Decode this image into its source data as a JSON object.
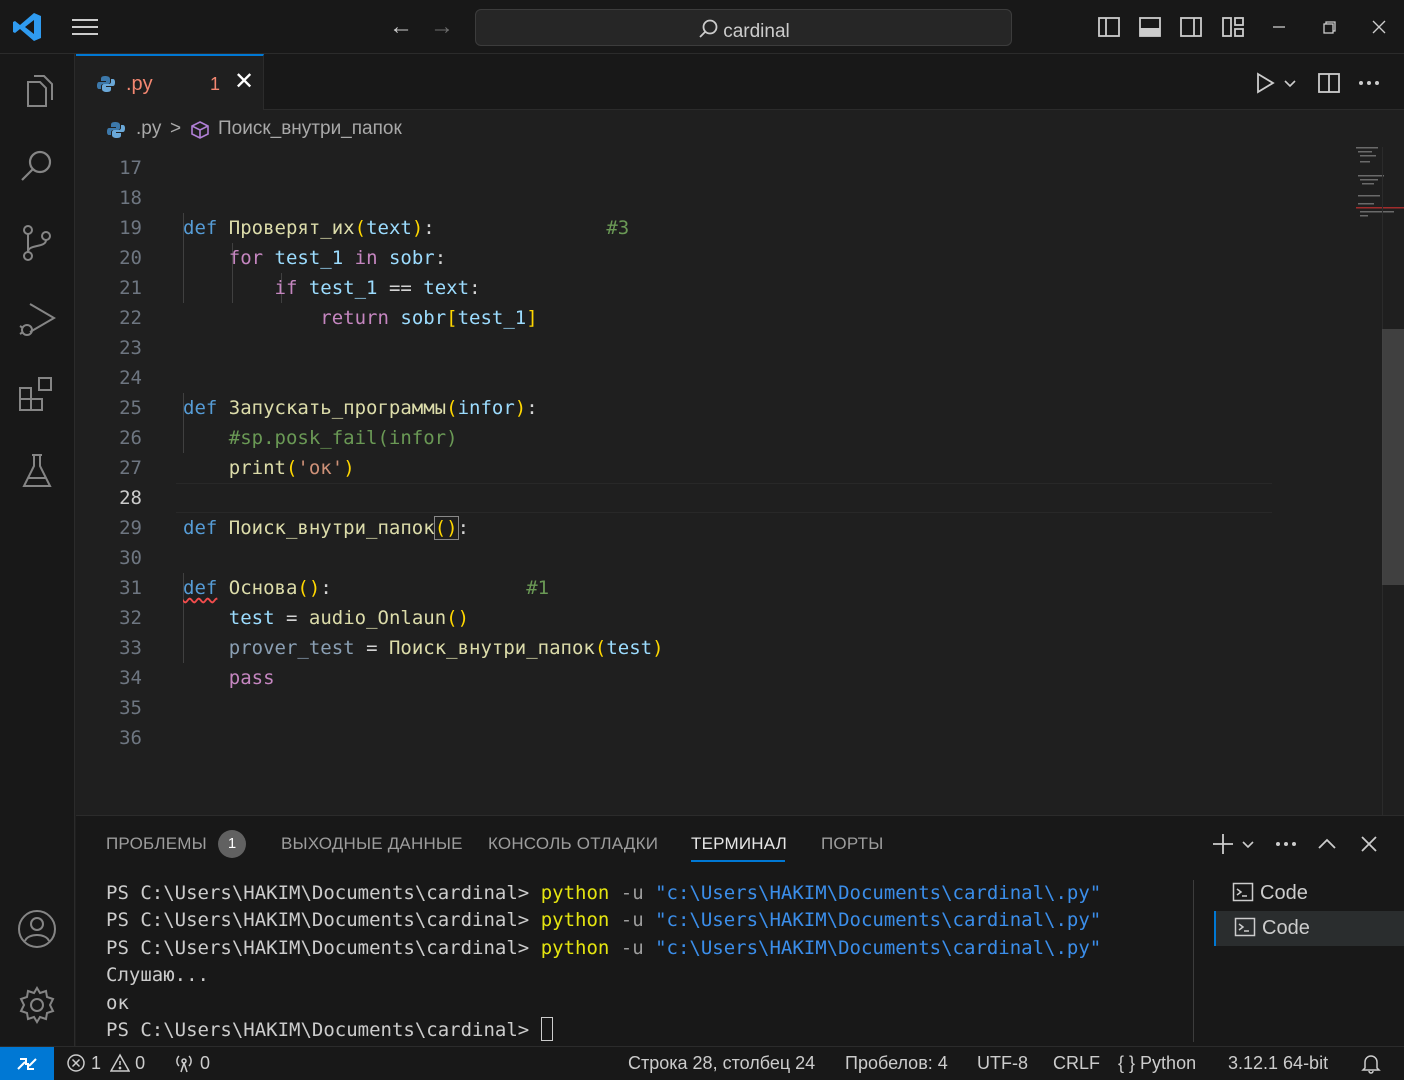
{
  "titlebar": {
    "search_text": "cardinal"
  },
  "tab": {
    "name": ".py",
    "problem_count": "1",
    "close_glyph": "✕"
  },
  "breadcrumb": {
    "file": ".py",
    "separator": ">",
    "symbol": "Поиск_внутри_папок"
  },
  "editor": {
    "line_numbers": [
      "17",
      "18",
      "19",
      "20",
      "21",
      "22",
      "23",
      "24",
      "25",
      "26",
      "27",
      "28",
      "29",
      "30",
      "31",
      "32",
      "33",
      "34",
      "35",
      "36"
    ],
    "active_line": "28"
  },
  "panel": {
    "tabs": [
      "ПРОБЛЕМЫ",
      "ВЫХОДНЫЕ ДАННЫЕ",
      "КОНСОЛЬ ОТЛАДКИ",
      "ТЕРМИНАЛ",
      "ПОРТЫ"
    ],
    "problems_badge": "1",
    "active_tab": "ТЕРМИНАЛ",
    "terminal_lines": [
      {
        "prompt": "PS C:\\Users\\HAKIM\\Documents\\cardinal> ",
        "cmd": "python",
        "flag": " -u ",
        "arg": "\"c:\\Users\\HAKIM\\Documents\\cardinal\\.py\""
      },
      {
        "prompt": "PS C:\\Users\\HAKIM\\Documents\\cardinal> ",
        "cmd": "python",
        "flag": " -u ",
        "arg": "\"c:\\Users\\HAKIM\\Documents\\cardinal\\.py\""
      },
      {
        "prompt": "PS C:\\Users\\HAKIM\\Documents\\cardinal> ",
        "cmd": "python",
        "flag": " -u ",
        "arg": "\"c:\\Users\\HAKIM\\Documents\\cardinal\\.py\""
      }
    ],
    "output_1": "Слушаю...",
    "output_2": "ок",
    "last_prompt": "PS C:\\Users\\HAKIM\\Documents\\cardinal> ",
    "terminal_instances": [
      "Code",
      "Code"
    ]
  },
  "statusbar": {
    "errors": "1",
    "warnings": "0",
    "ports": "0",
    "position": "Строка 28, столбец 24",
    "spaces": "Пробелов: 4",
    "encoding": "UTF-8",
    "eol": "CRLF",
    "language_braces": "{ }",
    "language": "Python",
    "interpreter": "3.12.1 64-bit"
  },
  "icons": {
    "logo": "vscode-logo-icon",
    "menu": "hamburger-menu-icon",
    "accent": "#0078d4"
  }
}
